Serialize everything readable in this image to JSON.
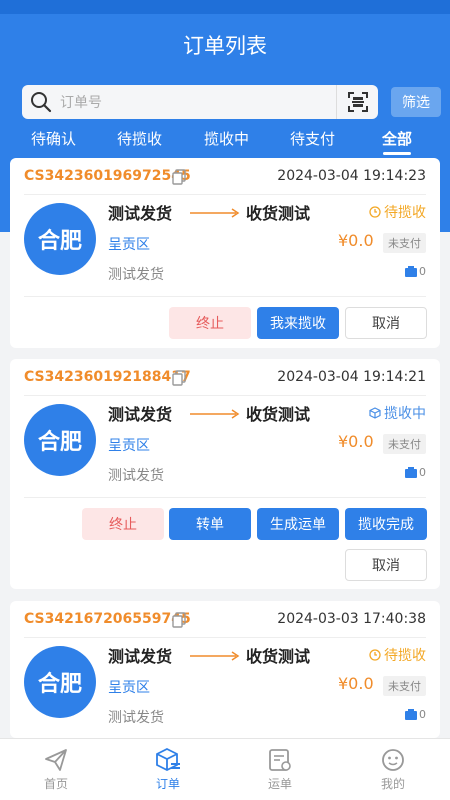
{
  "header": {
    "title": "订单列表"
  },
  "search": {
    "placeholder": "订单号",
    "filter_label": "筛选"
  },
  "tabs": [
    {
      "label": "待确认"
    },
    {
      "label": "待揽收"
    },
    {
      "label": "揽收中"
    },
    {
      "label": "待支付"
    },
    {
      "label": "全部",
      "active": true
    }
  ],
  "orders": [
    {
      "order_no": "CS342360196972545",
      "time": "2024-03-04 19:14:23",
      "city": "合肥",
      "from": "测试发货",
      "to": "收货测试",
      "status": "待揽收",
      "district": "呈贡区",
      "price": "¥0.0",
      "pay_status": "未支付",
      "goods": "测试发货",
      "box_count": "0",
      "buttons": [
        "终止",
        "我来揽收",
        "取消"
      ]
    },
    {
      "order_no": "CS342360192188417",
      "time": "2024-03-04 19:14:21",
      "city": "合肥",
      "from": "测试发货",
      "to": "收货测试",
      "status": "揽收中",
      "district": "呈贡区",
      "price": "¥0.0",
      "pay_status": "未支付",
      "goods": "测试发货",
      "box_count": "0",
      "buttons": [
        "终止",
        "转单",
        "生成运单",
        "揽收完成",
        "取消"
      ]
    },
    {
      "order_no": "CS342167206559745",
      "time": "2024-03-03 17:40:38",
      "city": "合肥",
      "from": "测试发货",
      "to": "收货测试",
      "status": "待揽收",
      "district": "呈贡区",
      "price": "¥0.0",
      "pay_status": "未支付",
      "goods": "测试发货",
      "box_count": "0"
    }
  ],
  "nav": [
    {
      "label": "首页",
      "icon": "paper-plane-icon"
    },
    {
      "label": "订单",
      "icon": "order-box-icon",
      "active": true
    },
    {
      "label": "运单",
      "icon": "waybill-icon"
    },
    {
      "label": "我的",
      "icon": "profile-face-icon"
    }
  ],
  "colors": {
    "primary": "#2f80e8",
    "order_no": "#f08c2b",
    "waiting": "#f3a826",
    "stop_bg": "#fde6e6"
  }
}
